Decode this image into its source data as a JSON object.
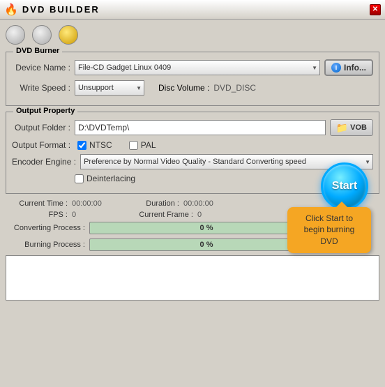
{
  "titleBar": {
    "title": "DVD  BUILDER",
    "closeLabel": "✕"
  },
  "trafficLights": {
    "btn1": "gray",
    "btn2": "gray",
    "btn3": "yellow"
  },
  "dvdBurner": {
    "groupLabel": "DVD Burner",
    "deviceNameLabel": "Device Name :",
    "deviceNameValue": "File-CD Gadget  Linux   0409",
    "infoButtonLabel": "Info...",
    "writeSpeedLabel": "Write Speed :",
    "writeSpeedValue": "Unsupport",
    "discVolumeLabel": "Disc Volume :",
    "discVolumeValue": "DVD_DISC"
  },
  "outputProperty": {
    "groupLabel": "Output Property",
    "outputFolderLabel": "Output Folder :",
    "outputFolderValue": "D:\\DVDTemp\\",
    "vobButtonLabel": "VOB",
    "outputFormatLabel": "Output Format :",
    "ntscLabel": "NTSC",
    "palLabel": "PAL",
    "ntscChecked": true,
    "palChecked": false,
    "encoderEngineLabel": "Encoder Engine :",
    "encoderEngineValue": "Preference by Normal Video Quality - Standard Converting speed",
    "deinterlacingLabel": "Deinterlacing",
    "deinterlacingChecked": false
  },
  "stats": {
    "currentTimeLabel": "Current Time :",
    "currentTimeValue": "00:00:00",
    "durationLabel": "Duration :",
    "durationValue": "00:00:00",
    "fpsLabel": "FPS :",
    "fpsValue": "0",
    "currentFrameLabel": "Current Frame :",
    "currentFrameValue": "0"
  },
  "progress": {
    "convertingLabel": "Converting Process :",
    "convertingPercent": "0 %",
    "convertingValue": 0,
    "burningLabel": "Burning Process :",
    "burningPercent": "0 %",
    "burningValue": 0
  },
  "startButton": {
    "label": "Start"
  },
  "tooltip": {
    "text": "Click Start to begin burning DVD"
  },
  "logArea": {
    "content": ""
  }
}
